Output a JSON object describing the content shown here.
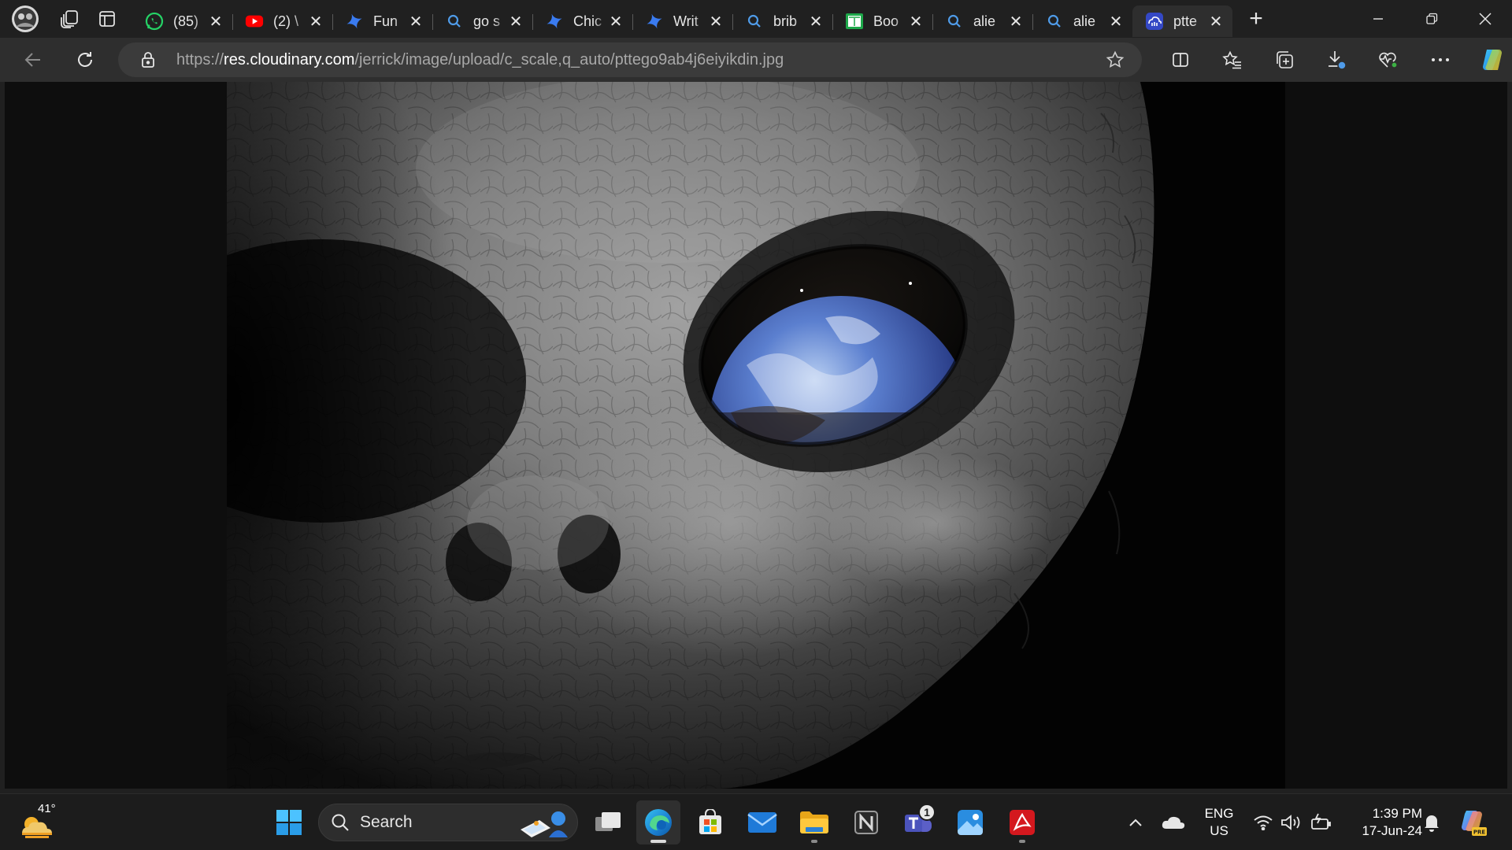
{
  "browser": {
    "tabs": [
      {
        "title": "(85)",
        "icon": "whatsapp-icon",
        "active": false
      },
      {
        "title": "(2) \\",
        "icon": "youtube-icon",
        "active": false
      },
      {
        "title": "Fun",
        "icon": "star-spark-icon",
        "active": false
      },
      {
        "title": "go s",
        "icon": "search-icon",
        "active": false
      },
      {
        "title": "Chic",
        "icon": "star-spark-icon",
        "active": false
      },
      {
        "title": "Writ",
        "icon": "star-spark-icon",
        "active": false
      },
      {
        "title": "brib",
        "icon": "search-icon",
        "active": false
      },
      {
        "title": "Boo",
        "icon": "book-icon",
        "active": false
      },
      {
        "title": "alie",
        "icon": "search-icon",
        "active": false
      },
      {
        "title": "alie",
        "icon": "search-icon",
        "active": false
      },
      {
        "title": "ptte",
        "icon": "cloudinary-icon",
        "active": true
      }
    ],
    "new_tab_label": "+",
    "close_glyph": "✕",
    "address": {
      "scheme": "https://",
      "host": "res.cloudinary.com",
      "path": "/jerrick/image/upload/c_scale,q_auto/pttego9ab4j6eiyikdin.jpg"
    }
  },
  "taskbar": {
    "weather_temp": "41°",
    "search_label": "Search",
    "teams_badge": "1",
    "language": {
      "line1": "ENG",
      "line2": "US"
    },
    "clock": {
      "time": "1:39 PM",
      "date": "17-Jun-24"
    }
  },
  "colors": {
    "tabstrip_bg": "#202020",
    "toolbar_bg": "#2e2e2e",
    "address_bg": "#3b3b3b",
    "taskbar_bg": "#1c1c1c",
    "whatsapp": "#25d366",
    "youtube": "#ff0000",
    "edge_blue": "#1b7fd1"
  }
}
